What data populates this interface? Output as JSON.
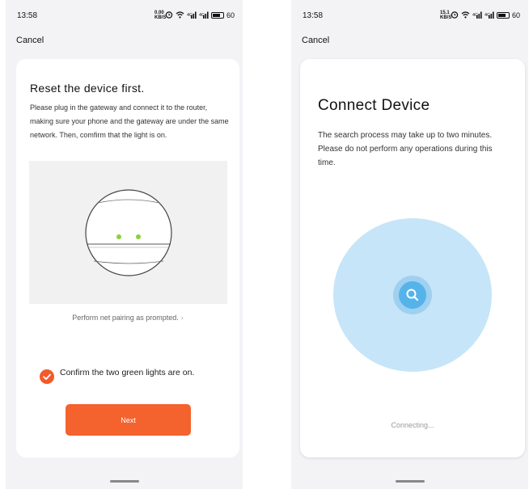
{
  "left_screen": {
    "status_bar": {
      "time": "13:58",
      "speed_top": "0.00",
      "speed_bottom": "KB/S",
      "battery": "60"
    },
    "cancel_label": "Cancel",
    "title": "Reset the device first.",
    "description": "Please plug in the gateway and connect it to the router, making sure your phone and the gateway are under the same network. Then, comfirm that the light is on.",
    "illustration_icon": "gateway-device-illustration",
    "prompt_link": "Perform net pairing as prompted.",
    "prompt_chevron": "›",
    "confirm_checked": true,
    "confirm_text": "Confirm the two green lights are on.",
    "next_label": "Next",
    "accent_color": "#f4622d",
    "indicator_color": "#8bd13a"
  },
  "right_screen": {
    "status_bar": {
      "time": "13:58",
      "speed_top": "15.1",
      "speed_bottom": "KB/S",
      "battery": "60"
    },
    "cancel_label": "Cancel",
    "title": "Connect Device",
    "description": "The search process may take up to two minutes. Please do not perform any operations during this time.",
    "search_icon": "search-icon",
    "status_text": "Connecting...",
    "radar_color": "#c6e5f8",
    "search_button_color": "#55b3ea"
  }
}
